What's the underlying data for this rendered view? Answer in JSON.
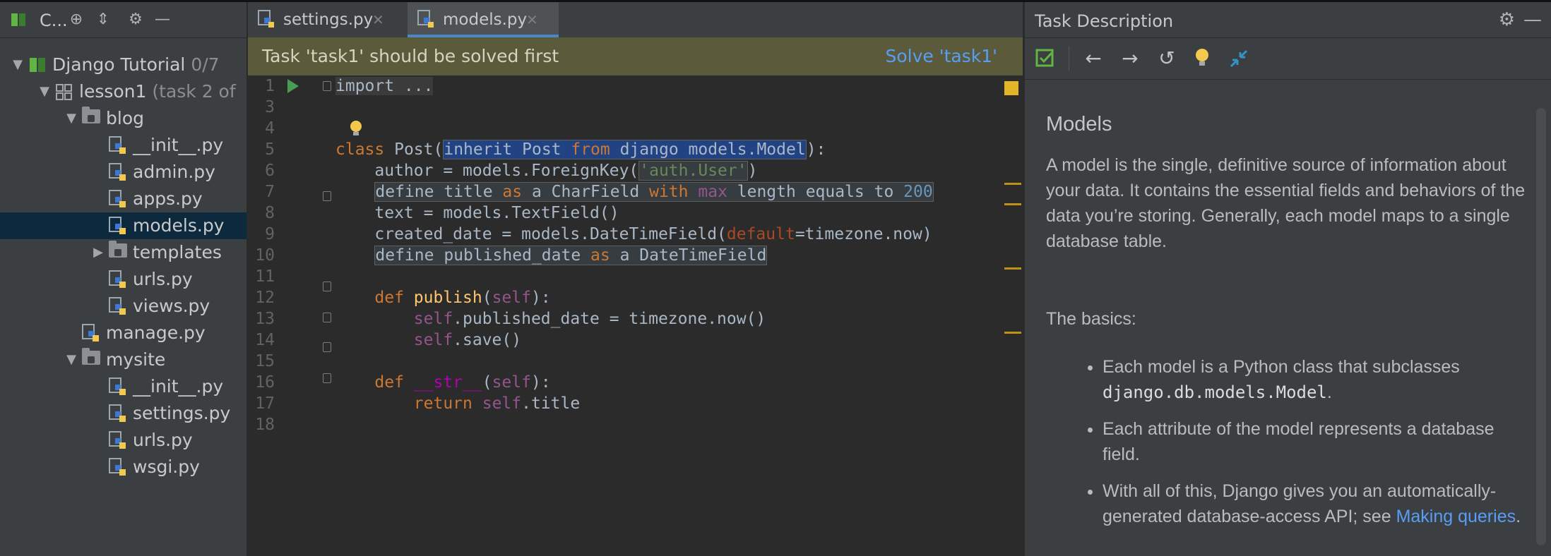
{
  "project": {
    "title": "C...",
    "tree": [
      {
        "label": "Django Tutorial",
        "extra": "0/7",
        "indent": 0,
        "kind": "book",
        "expanded": true
      },
      {
        "label": "lesson1",
        "extra": "(task 2 of",
        "indent": 1,
        "kind": "lesson",
        "expanded": true
      },
      {
        "label": "blog",
        "extra": "",
        "indent": 2,
        "kind": "folder",
        "expanded": true
      },
      {
        "label": "__init__.py",
        "extra": "",
        "indent": 3,
        "kind": "py"
      },
      {
        "label": "admin.py",
        "extra": "",
        "indent": 3,
        "kind": "py"
      },
      {
        "label": "apps.py",
        "extra": "",
        "indent": 3,
        "kind": "py"
      },
      {
        "label": "models.py",
        "extra": "",
        "indent": 3,
        "kind": "py",
        "selected": true
      },
      {
        "label": "templates",
        "extra": "",
        "indent": 3,
        "kind": "folder",
        "expanded": false
      },
      {
        "label": "urls.py",
        "extra": "",
        "indent": 3,
        "kind": "py"
      },
      {
        "label": "views.py",
        "extra": "",
        "indent": 3,
        "kind": "py"
      },
      {
        "label": "manage.py",
        "extra": "",
        "indent": 2,
        "kind": "py"
      },
      {
        "label": "mysite",
        "extra": "",
        "indent": 2,
        "kind": "folder",
        "expanded": true
      },
      {
        "label": "__init__.py",
        "extra": "",
        "indent": 3,
        "kind": "py"
      },
      {
        "label": "settings.py",
        "extra": "",
        "indent": 3,
        "kind": "py"
      },
      {
        "label": "urls.py",
        "extra": "",
        "indent": 3,
        "kind": "py"
      },
      {
        "label": "wsgi.py",
        "extra": "",
        "indent": 3,
        "kind": "py"
      }
    ]
  },
  "editor": {
    "tabs": [
      {
        "label": "settings.py",
        "active": false
      },
      {
        "label": "models.py",
        "active": true
      }
    ],
    "banner": {
      "message": "Task 'task1' should be solved first",
      "action": "Solve 'task1'"
    },
    "lines": [
      {
        "n": "1",
        "html": "<span class='fold'>import ...</span>"
      },
      {
        "n": "3",
        "html": ""
      },
      {
        "n": "4",
        "html": ""
      },
      {
        "n": "5",
        "html": "<span class='kw'>class </span>Post(<span class='ph phsel'>inherit Post <span class='kw'>from</span> django models.Model</span>):"
      },
      {
        "n": "6",
        "html": "    author = models.ForeignKey(<span class='ph'><span class='str'>'auth.User'</span></span>)"
      },
      {
        "n": "7",
        "html": "    <span class='ph'>define title <span class='kw'>as</span> a CharField <span class='kw'>with</span> <span class='self'>max</span> length equals to <span class='num'>200</span></span>"
      },
      {
        "n": "8",
        "html": "    text = models.TextField()"
      },
      {
        "n": "9",
        "html": "    created_date = models.DateTimeField(<span class='param'>default</span>=timezone.now)"
      },
      {
        "n": "10",
        "html": "    <span class='ph'>define published_date <span class='kw'>as</span> a DateTimeField</span>"
      },
      {
        "n": "11",
        "html": ""
      },
      {
        "n": "12",
        "html": "    <span class='kw'>def </span><span class='fn'>publish</span>(<span class='self'>self</span>):"
      },
      {
        "n": "13",
        "html": "        <span class='self'>self</span>.published_date = timezone.now()"
      },
      {
        "n": "14",
        "html": "        <span class='self'>self</span>.save()"
      },
      {
        "n": "15",
        "html": ""
      },
      {
        "n": "16",
        "html": "    <span class='kw'>def </span><span class='dund'>__str__</span>(<span class='self'>self</span>):"
      },
      {
        "n": "17",
        "html": "        <span class='kw'>return </span><span class='self'>self</span>.title"
      },
      {
        "n": "18",
        "html": ""
      }
    ]
  },
  "task": {
    "panel_title": "Task Description",
    "heading": "Models",
    "intro": "A model is the single, definitive source of information about your data. It contains the essential fields and behaviors of the data you’re storing. Generally, each model maps to a single database table.",
    "basics_title": "The basics:",
    "b1_pre": "Each model is a Python class that subclasses",
    "b1_code": "django.db.models.Model",
    "b1_post": ".",
    "b2": "Each attribute of the model represents a database field.",
    "b3_pre": "With all of this, Django gives you an automatically-generated database-access API; see",
    "b3_link": "Making queries",
    "b3_post": "."
  },
  "colors": {
    "accent": "#4a88c7",
    "banner_bg": "#5b5b3b",
    "link": "#589df6",
    "keyword": "#cc7832",
    "string": "#6a8759"
  }
}
